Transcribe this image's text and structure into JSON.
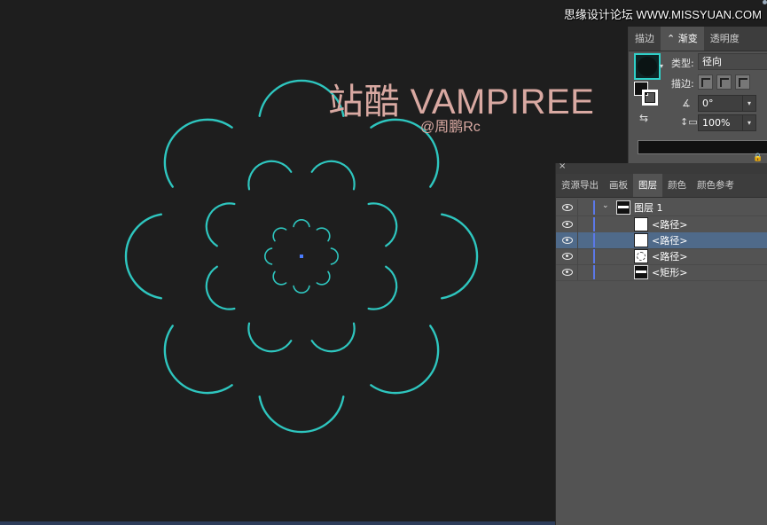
{
  "watermark": {
    "title": "站酷 VAMPIREE",
    "subtitle": "@周鹏Rc",
    "site_logo": "思缘设计论坛 WWW.MISSYUAN.COM"
  },
  "colors": {
    "canvas_bg": "#1e1e1e",
    "stroke_accent": "#2fd0c8",
    "center_point": "#4a7cff",
    "watermark": "#d9a9a2",
    "selected_row": "#4f6a8a",
    "layer_color_bar": "#5b78e8"
  },
  "gradient_panel": {
    "tabs": [
      {
        "label": "描边",
        "active": false
      },
      {
        "label": "渐变",
        "active": true
      },
      {
        "label": "透明度",
        "active": false
      }
    ],
    "type_label": "类型:",
    "type_value": "径向",
    "stroke_label": "描边:",
    "angle_value": "0°",
    "aspect_value": "100%",
    "icons": [
      "fill-stroke-swap-icon",
      "reverse-gradient-icon",
      "angle-icon",
      "aspect-ratio-icon",
      "lock-icon"
    ]
  },
  "layers_panel": {
    "tabs": [
      {
        "label": "资源导出",
        "active": false
      },
      {
        "label": "画板",
        "active": false
      },
      {
        "label": "图层",
        "active": true
      },
      {
        "label": "颜色",
        "active": false
      },
      {
        "label": "颜色参考",
        "active": false
      }
    ],
    "layers": [
      {
        "name": "图层 1",
        "kind": "layer",
        "selected": false
      },
      {
        "name": "<路径>",
        "kind": "path",
        "selected": false
      },
      {
        "name": "<路径>",
        "kind": "path",
        "selected": true
      },
      {
        "name": "<路径>",
        "kind": "path-dotted",
        "selected": false
      },
      {
        "name": "<矩形>",
        "kind": "rect",
        "selected": false
      }
    ]
  }
}
